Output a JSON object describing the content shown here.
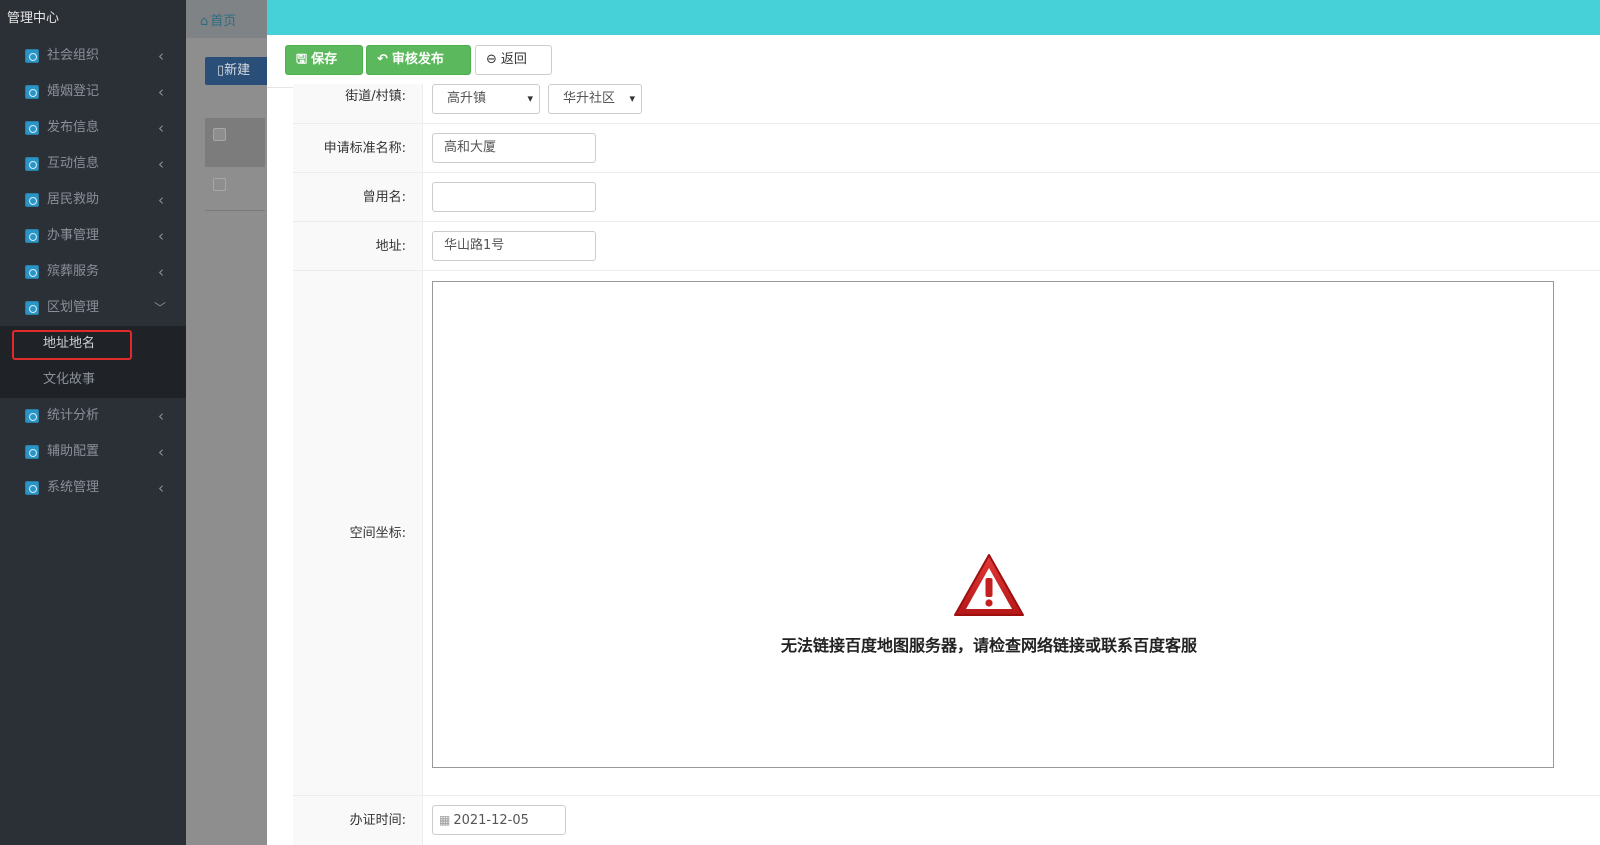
{
  "sidebar": {
    "brand": "管理中心",
    "items": [
      {
        "label": "社会组织"
      },
      {
        "label": "婚姻登记"
      },
      {
        "label": "发布信息"
      },
      {
        "label": "互动信息"
      },
      {
        "label": "居民救助"
      },
      {
        "label": "办事管理"
      },
      {
        "label": "殡葬服务"
      },
      {
        "label": "区划管理"
      },
      {
        "label": "统计分析"
      },
      {
        "label": "辅助配置"
      },
      {
        "label": "系统管理"
      }
    ],
    "submenu": [
      {
        "label": "地址地名"
      },
      {
        "label": "文化故事"
      }
    ]
  },
  "background": {
    "home_label": "首页",
    "new_button": "新建"
  },
  "toolbar": {
    "save_label": "保存",
    "publish_label": "审核发布",
    "back_label": "返回"
  },
  "form": {
    "street": {
      "label": "街道/村镇:",
      "town_value": "高升镇",
      "community_value": "华升社区"
    },
    "std_name": {
      "label": "申请标准名称:",
      "value": "高和大厦"
    },
    "alias": {
      "label": "曾用名:",
      "value": ""
    },
    "address": {
      "label": "地址:",
      "value": "华山路1号"
    },
    "coords": {
      "label": "空间坐标:",
      "map_error": "无法链接百度地图服务器，请检查网络链接或联系百度客服"
    },
    "issue_date": {
      "label": "办证时间:",
      "value": "2021-12-05"
    }
  },
  "colors": {
    "modal_header": "#46d1d8",
    "success": "#5cb85c",
    "sidebar_bg": "#2b2f36",
    "highlight": "#e12b2b"
  }
}
